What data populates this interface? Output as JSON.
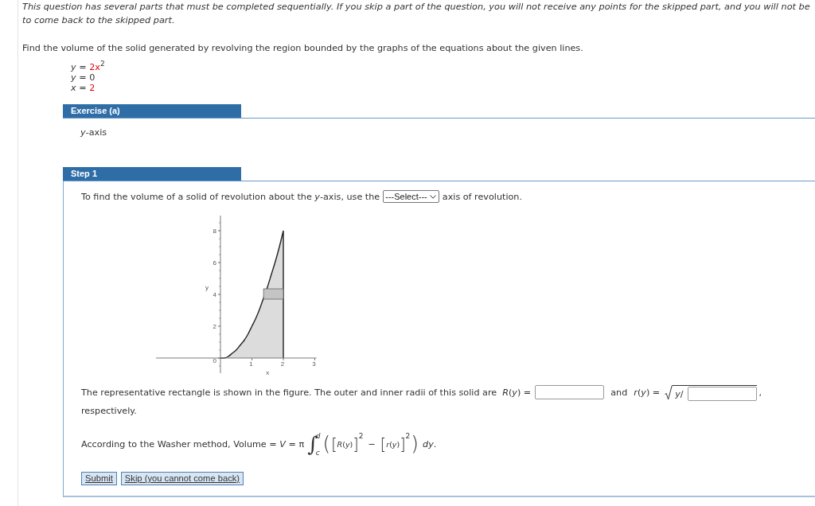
{
  "notice": {
    "lines": [
      "This question has several parts that must be completed sequentially. If you skip a part of the question, you will not receive any points for the skipped part, and you will not be",
      "to come back to the skipped part."
    ]
  },
  "problem": {
    "prompt": "Find the volume of the solid generated by revolving the region bounded by the graphs of the equations about the given lines.",
    "equations": [
      {
        "variable": "y",
        "relation": "=",
        "value": "2x",
        "exponent": "2",
        "highlighted": true
      },
      {
        "variable": "y",
        "relation": "=",
        "value": "0",
        "highlighted": false
      },
      {
        "variable": "x",
        "relation": "=",
        "value": "2",
        "highlighted": true
      }
    ]
  },
  "exercise": {
    "title": "Exercise (a)",
    "axis": "*y*-axis"
  },
  "step": {
    "title": "Step 1",
    "instruction": {
      "before": "To find the volume of a solid of revolution about the *y*-axis, use the",
      "select": "---Select---",
      "after": "axis of revolution."
    },
    "figure": {
      "chart_data": {
        "type": "area",
        "xlabel": "x",
        "ylabel": "y",
        "x": [
          0,
          0.125,
          0.25,
          0.375,
          0.5,
          0.625,
          0.75,
          0.875,
          1,
          1.125,
          1.25,
          1.375,
          1.5,
          1.625,
          1.75,
          1.875,
          2
        ],
        "values": [
          0,
          0,
          0.1,
          0.3,
          0.5,
          0.8,
          1.1,
          1.5,
          2,
          2.5,
          3.1,
          3.8,
          4.5,
          5.3,
          6.1,
          7,
          8
        ],
        "xlim": [
          -2.05,
          3.05
        ],
        "ylim": [
          -0.95,
          8.95
        ],
        "xticks": [
          {
            "value": 1,
            "label": "1"
          },
          {
            "value": 2,
            "label": "2"
          },
          {
            "value": 3,
            "label": "3"
          }
        ],
        "yticks": [
          {
            "value": 0,
            "label": "0"
          },
          {
            "value": 2,
            "label": "2"
          },
          {
            "value": 4,
            "label": "4"
          },
          {
            "value": 6,
            "label": "6"
          },
          {
            "value": 8,
            "label": "8"
          }
        ]
      }
    },
    "radii": {
      "text": "The representative rectangle is shown in the figure. The outer and inner radii of this solid are",
      "outer_label": "*R*(*y*) =",
      "conjunction": "and",
      "inner_label": "*r*(*y*) =",
      "inner_radicand": "*y*/",
      "trailing": ",",
      "continuation": "respectively."
    },
    "washer": {
      "text": "According to the Washer method,  Volume = *V* = π",
      "formula": [
        {
          "kind": "integral",
          "sign": "∫",
          "upper": "*d*",
          "lower": "*c*"
        },
        {
          "kind": "symbol",
          "value": "("
        },
        {
          "kind": "bracket",
          "open": "[",
          "inner": "*R*(*y*)",
          "close": "]",
          "power": "2"
        },
        {
          "kind": "operator",
          "value": "−"
        },
        {
          "kind": "bracket",
          "open": "[",
          "inner": "*r*(*y*)",
          "close": "]",
          "power": "2"
        },
        {
          "kind": "symbol",
          "value": ")"
        },
        {
          "kind": "text",
          "value": "*dy*."
        }
      ]
    },
    "buttons": [
      "Submit",
      "Skip (you cannot come back)"
    ]
  }
}
